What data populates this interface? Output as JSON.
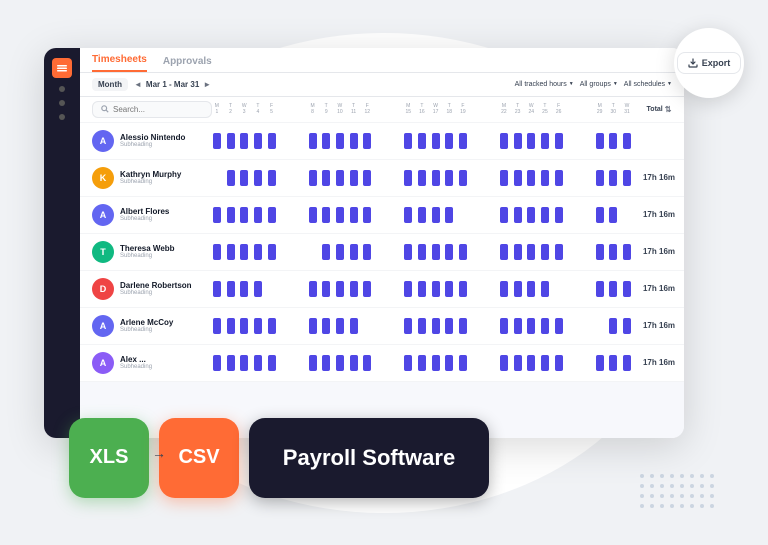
{
  "brand": {
    "icon": "≡"
  },
  "tabs": [
    {
      "label": "Timesheets",
      "active": true
    },
    {
      "label": "Approvals",
      "active": false
    }
  ],
  "toolbar": {
    "month_label": "Month",
    "period": "◄  Mar 1 - Mar 31  ►",
    "filters": [
      "All tracked hours",
      "All groups",
      "All schedules"
    ]
  },
  "search": {
    "placeholder": "Search..."
  },
  "calendar": {
    "days": [
      "M",
      "T",
      "W",
      "T",
      "F",
      "",
      "",
      "M",
      "T",
      "W",
      "T",
      "F",
      "",
      "",
      "M",
      "T",
      "W",
      "T",
      "F",
      "",
      "",
      "M",
      "T",
      "W",
      "T",
      "F",
      "",
      "",
      "M",
      "T",
      "W"
    ],
    "dates": [
      "1",
      "2",
      "3",
      "4",
      "5",
      "",
      "",
      "8",
      "9",
      "10",
      "11",
      "12",
      "",
      "",
      "15",
      "16",
      "17",
      "18",
      "19",
      "",
      "",
      "22",
      "23",
      "24",
      "25",
      "26",
      "",
      "",
      "29",
      "30",
      "31"
    ],
    "total_header": "Total"
  },
  "employees": [
    {
      "name": "Alessio Nintendo",
      "sub": "Subheading",
      "avatar_letter": "A",
      "avatar_color": "#6366f1",
      "total": ""
    },
    {
      "name": "Kathryn Murphy",
      "sub": "Subheading",
      "avatar_letter": "K",
      "avatar_color": "#f59e0b",
      "total": "17h 16m"
    },
    {
      "name": "Albert Flores",
      "sub": "Subheading",
      "avatar_letter": "A",
      "avatar_color": "#6366f1",
      "total": "17h 16m"
    },
    {
      "name": "Theresa Webb",
      "sub": "Subheading",
      "avatar_letter": "T",
      "avatar_color": "#10b981",
      "total": "17h 16m"
    },
    {
      "name": "Darlene Robertson",
      "sub": "Subheading",
      "avatar_letter": "D",
      "avatar_color": "#ef4444",
      "total": "17h 16m"
    },
    {
      "name": "Arlene McCoy",
      "sub": "Subheading",
      "avatar_letter": "A",
      "avatar_color": "#6366f1",
      "total": "17h 16m"
    },
    {
      "name": "Alex ...",
      "sub": "Subheading",
      "avatar_letter": "A",
      "avatar_color": "#8b5cf6",
      "total": "17h 16m"
    }
  ],
  "export_btn": "Export",
  "badges": {
    "xls": "XLS",
    "csv": "CSV",
    "payroll": "Payroll Software"
  }
}
